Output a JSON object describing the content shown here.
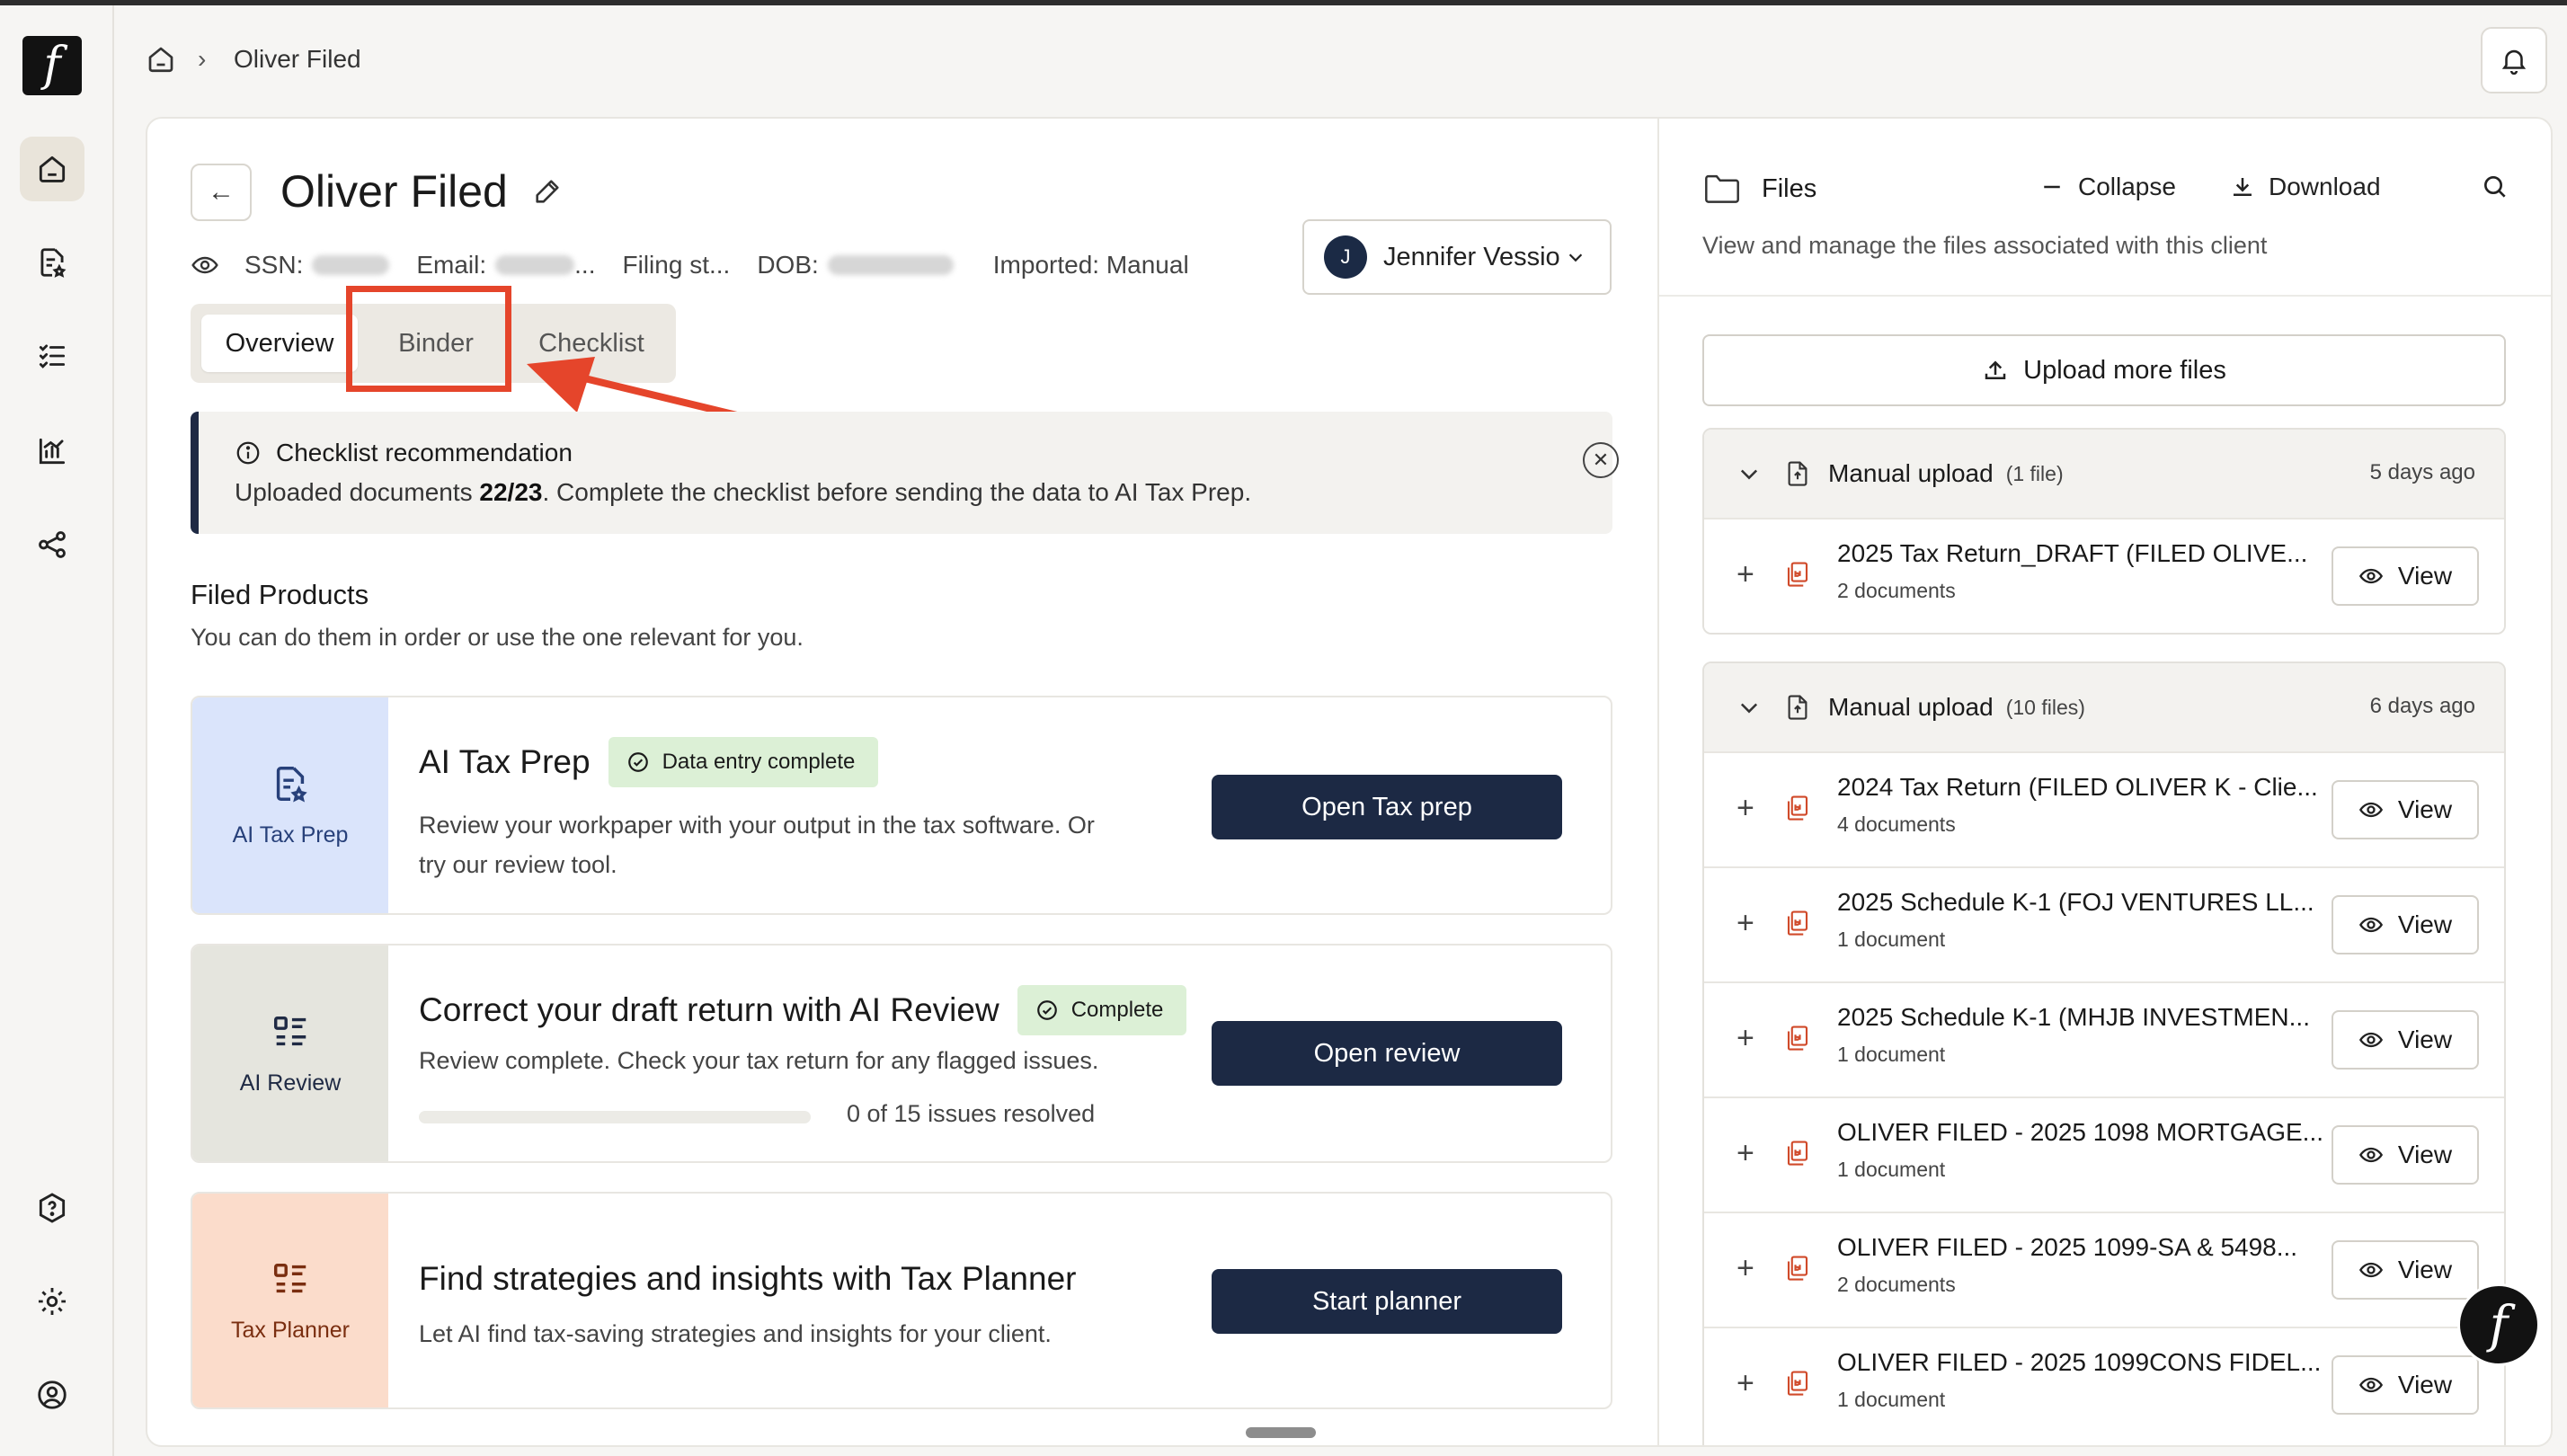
{
  "app": {
    "logo_glyph": "f",
    "accent": "#1c2944",
    "highlight": "#e5452b"
  },
  "breadcrumb": {
    "current": "Oliver Filed",
    "separator": "›"
  },
  "client": {
    "name": "Oliver Filed",
    "ssn_label": "SSN:",
    "email_label": "Email:",
    "email_suffix": "...",
    "filing_status": "Filing st...",
    "dob_label": "DOB:",
    "imported": "Imported: Manual",
    "assignee_initial": "J",
    "assignee_name": "Jennifer Vessio"
  },
  "tabs": [
    "Overview",
    "Binder",
    "Checklist"
  ],
  "banner": {
    "title": "Checklist recommendation",
    "text_before": "Uploaded documents ",
    "text_count": "22/23",
    "text_after": ". Complete the checklist before sending the data to AI Tax Prep.",
    "close": "✕"
  },
  "products_section": {
    "title": "Filed Products",
    "subtitle": "You can do them in order or use the one relevant for you.",
    "items": [
      {
        "tile_label": "AI Tax Prep",
        "title": "AI Tax Prep",
        "badge": "Data entry complete",
        "desc_line1": "Review your workpaper with your output in the tax software. Or",
        "desc_line2": "try our review tool.",
        "button": "Open Tax prep",
        "tile_color": "#dae4fb"
      },
      {
        "tile_label": "AI Review",
        "title": "Correct your draft return with AI Review",
        "badge": "Complete",
        "desc_line1": "Review complete. Check your tax return for any flagged issues.",
        "progress_label": "0 of 15 issues resolved",
        "progress_fraction": 0,
        "button": "Open review",
        "tile_color": "#e5e5de"
      },
      {
        "tile_label": "Tax Planner",
        "title": "Find strategies and insights with Tax Planner",
        "desc_line1": "Let AI find tax-saving strategies and insights for your client.",
        "button": "Start planner",
        "tile_color": "#fbdccb"
      }
    ]
  },
  "files": {
    "title": "Files",
    "collapse": "Collapse",
    "download": "Download",
    "subtitle": "View and manage the files associated with this client",
    "upload_button": "Upload more files",
    "view_label": "View",
    "groups": [
      {
        "label": "Manual upload",
        "count": "(1 file)",
        "time": "5 days ago",
        "files": [
          {
            "name": "2025 Tax Return_DRAFT (FILED OLIVE...",
            "count": "2 documents"
          }
        ]
      },
      {
        "label": "Manual upload",
        "count": "(10 files)",
        "time": "6 days ago",
        "files": [
          {
            "name": "2024 Tax Return (FILED OLIVER K - Clie...",
            "count": "4 documents"
          },
          {
            "name": "2025 Schedule K-1 (FOJ VENTURES LL...",
            "count": "1 document"
          },
          {
            "name": "2025 Schedule K-1 (MHJB INVESTMEN...",
            "count": "1 document"
          },
          {
            "name": "OLIVER FILED - 2025 1098 MORTGAGE...",
            "count": "1 document"
          },
          {
            "name": "OLIVER FILED - 2025 1099-SA & 5498...",
            "count": "2 documents"
          },
          {
            "name": "OLIVER FILED - 2025 1099CONS FIDEL...",
            "count": "1 document"
          }
        ]
      }
    ]
  }
}
